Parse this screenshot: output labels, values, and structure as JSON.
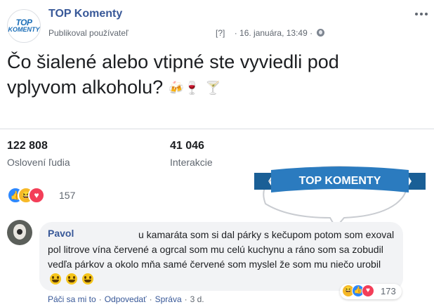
{
  "page": {
    "name": "TOP Komenty",
    "logo_line1": "TOP",
    "logo_line2": "KOMENTY",
    "published_by": "Publikoval používateľ",
    "bracket_tag": "[?]",
    "date": "16. januára, 13:49",
    "more_icon": "ellipsis-icon",
    "audience_icon": "globe-icon"
  },
  "post": {
    "text": "Čo šialené alebo vtipné ste vyviedli pod vplyvom alkoholu?",
    "emojis": [
      "🍻",
      "🍷",
      "🍸"
    ]
  },
  "stats": {
    "reach_value": "122 808",
    "reach_label": "Oslovení ľudia",
    "engagement_value": "41 046",
    "engagement_label": "Interakcie"
  },
  "reactions": {
    "types": [
      "like",
      "haha",
      "love"
    ],
    "count": "157"
  },
  "badge": {
    "text": "TOP KOMENTY"
  },
  "comment": {
    "author": "Pavol",
    "text": "u kamaráta som si dal párky s kečupom potom som exoval pol litrove vína červené a ogrcal som mu celú kuchynu a ráno som sa zobudil vedľa párkov a okolo mňa samé červené som myslel že som mu niečo urobil",
    "reaction_types": [
      "haha",
      "like",
      "love"
    ],
    "reaction_count": "173",
    "actions": {
      "like": "Páči sa mi to",
      "reply": "Odpovedať",
      "message": "Správa",
      "time": "3 d."
    }
  }
}
